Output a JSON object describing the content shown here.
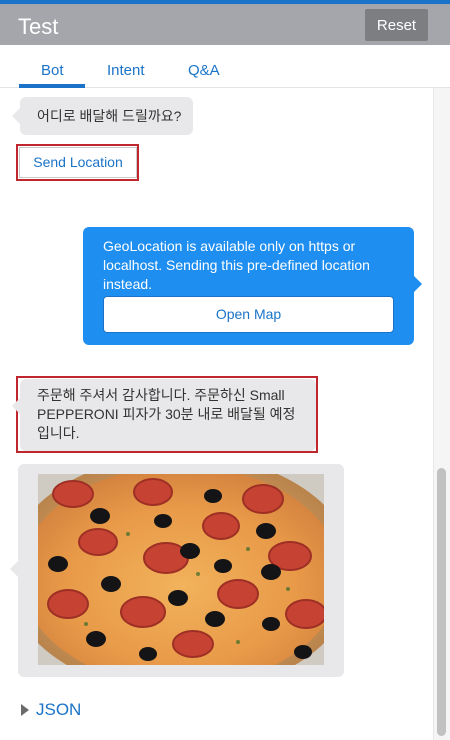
{
  "header": {
    "title": "Test",
    "reset_label": "Reset"
  },
  "tabs": [
    {
      "label": "Bot",
      "active": true
    },
    {
      "label": "Intent",
      "active": false
    },
    {
      "label": "Q&A",
      "active": false
    }
  ],
  "messages": {
    "bot_question": "어디로 배달해 드릴까요?",
    "send_location_label": "Send Location",
    "user_geo_text": "GeoLocation is available only on https or localhost.  Sending this pre-defined location instead.",
    "open_map_label": "Open Map",
    "bot_confirmation": "주문해 주셔서 감사합니다. 주문하신 Small PEPPERONI 피자가 30분 내로 배달될 예정입니다.",
    "pizza_image_icon": "pepperoni-pizza-photo"
  },
  "json_toggle": {
    "label": "JSON"
  },
  "colors": {
    "accent": "#1a73c8",
    "header_bg": "#a5a6ab",
    "user_bubble": "#1e8ef0",
    "bot_bubble": "#e8e8ea",
    "highlight": "#c0262d"
  }
}
